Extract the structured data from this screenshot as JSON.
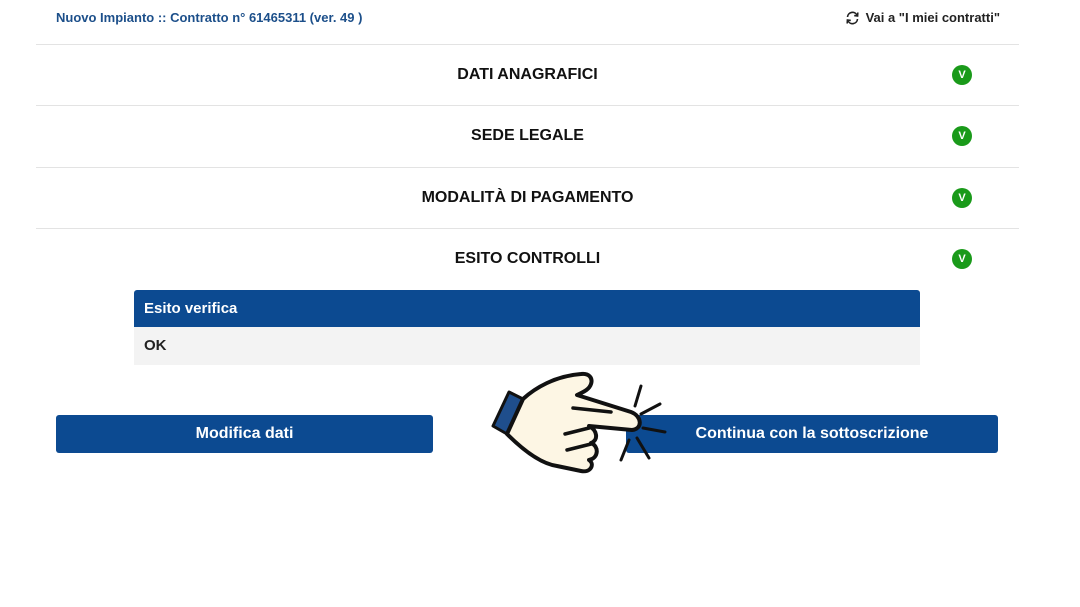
{
  "header": {
    "contract_title": "Nuovo Impianto :: Contratto n° 61465311 (ver. 49 )",
    "goto_link": "Vai a \"I miei contratti\""
  },
  "sections": [
    {
      "label": "DATI ANAGRAFICI",
      "status": "V"
    },
    {
      "label": "SEDE LEGALE",
      "status": "V"
    },
    {
      "label": "MODALITÀ DI PAGAMENTO",
      "status": "V"
    },
    {
      "label": "ESITO CONTROLLI",
      "status": "V"
    }
  ],
  "result": {
    "header": "Esito verifica",
    "value": "OK"
  },
  "buttons": {
    "modify": "Modifica dati",
    "continue": "Continua con la sottoscrizione"
  },
  "icons": {
    "goto_link": "refresh-icon",
    "status": "check-badge-icon",
    "pointer": "pointing-hand-icon"
  },
  "colors": {
    "primary": "#0c4a91",
    "title_link": "#1c4f8a",
    "success": "#1a9a1a"
  }
}
